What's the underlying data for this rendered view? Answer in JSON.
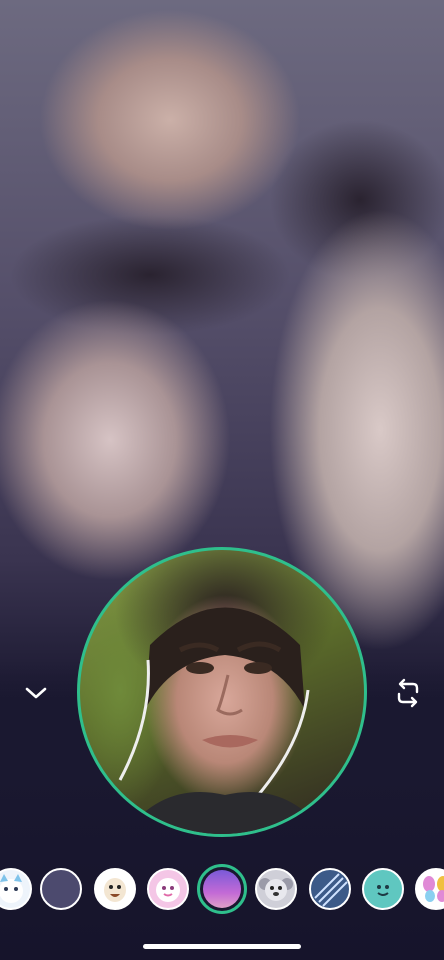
{
  "remote_video": {
    "description_icon": "remote-video-feed"
  },
  "self_preview": {
    "ring_color": "#2fbf8c"
  },
  "controls": {
    "collapse_icon": "chevron-down-icon",
    "flip_icon": "camera-flip-icon"
  },
  "filters": [
    {
      "icon": "cat-filter",
      "color": "#ffffff"
    },
    {
      "icon": "plain-filter",
      "color": "#4c4a6e"
    },
    {
      "icon": "bird-filter",
      "color": "#ffffff"
    },
    {
      "icon": "pink-face-filter",
      "color": "#f4c6e6"
    },
    {
      "icon": "purple-gradient-filter",
      "color": "#a86ad6"
    },
    {
      "icon": "koala-filter",
      "color": "#cfcfd8"
    },
    {
      "icon": "stripes-filter",
      "color": "#3c5a88"
    },
    {
      "icon": "teal-smile-filter",
      "color": "#5fc7c0"
    },
    {
      "icon": "butterfly-filter",
      "color": "#ffffff"
    }
  ],
  "selected_filter": "purple-gradient-filter",
  "accent_color": "#2fbf8c"
}
